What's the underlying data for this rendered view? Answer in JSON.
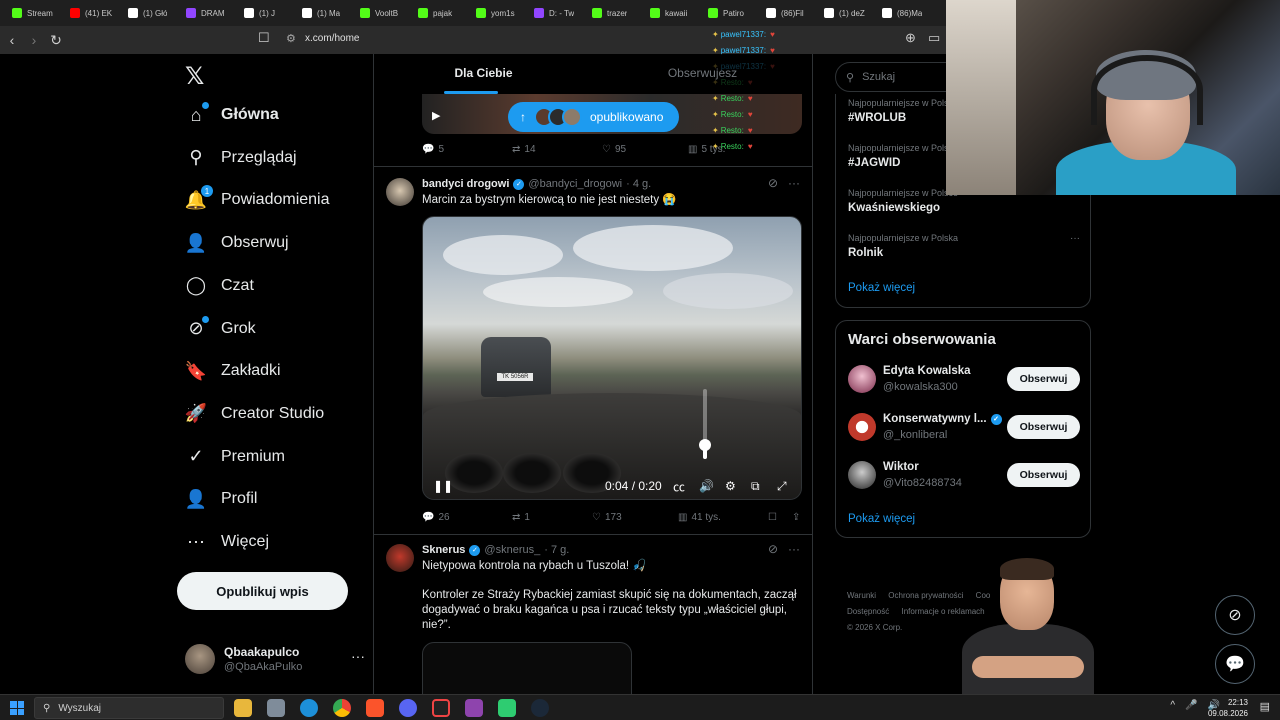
{
  "browser": {
    "tabs": [
      {
        "label": "Stream",
        "color": "#53fc18"
      },
      {
        "label": "(41) EK",
        "color": "#ff0000"
      },
      {
        "label": "(1) Głó",
        "color": "#ffffff"
      },
      {
        "label": "DRAM",
        "color": "#9146ff"
      },
      {
        "label": "(1) J",
        "color": "#ffffff"
      },
      {
        "label": "(1) Ma",
        "color": "#ffffff"
      },
      {
        "label": "VooltB",
        "color": "#53fc18"
      },
      {
        "label": "pajak",
        "color": "#53fc18"
      },
      {
        "label": "yom1s",
        "color": "#53fc18"
      },
      {
        "label": "D: - Tw",
        "color": "#9146ff"
      },
      {
        "label": "trazer",
        "color": "#53fc18"
      },
      {
        "label": "kawaii",
        "color": "#53fc18"
      },
      {
        "label": "Patiro",
        "color": "#53fc18"
      },
      {
        "label": "(86)Fil",
        "color": "#ffffff"
      },
      {
        "label": "(1) deZ",
        "color": "#ffffff"
      },
      {
        "label": "(86)Ma",
        "color": "#ffffff"
      }
    ],
    "url": "x.com/home"
  },
  "nav": {
    "items": [
      {
        "label": "Główna",
        "icon": "home-icon",
        "glyph": "⌂"
      },
      {
        "label": "Przeglądaj",
        "icon": "search-icon",
        "glyph": "⚲"
      },
      {
        "label": "Powiadomienia",
        "icon": "bell-icon",
        "glyph": "🔔",
        "badge": "1"
      },
      {
        "label": "Obserwuj",
        "icon": "person-add-icon",
        "glyph": "👤"
      },
      {
        "label": "Czat",
        "icon": "chat-icon",
        "glyph": "◯"
      },
      {
        "label": "Grok",
        "icon": "grok-icon",
        "glyph": "⊘"
      },
      {
        "label": "Zakładki",
        "icon": "bookmark-icon",
        "glyph": "🔖"
      },
      {
        "label": "Creator Studio",
        "icon": "rocket-icon",
        "glyph": "🚀"
      },
      {
        "label": "Premium",
        "icon": "verified-icon",
        "glyph": "✓"
      },
      {
        "label": "Profil",
        "icon": "profile-icon",
        "glyph": "👤"
      },
      {
        "label": "Więcej",
        "icon": "more-icon",
        "glyph": "⋯"
      }
    ],
    "post_button": "Opublikuj wpis",
    "user": {
      "name": "Qbaakapulco",
      "handle": "@QbaAkaPulko"
    }
  },
  "feed": {
    "tabs": [
      "Dla Ciebie",
      "Obserwujesz"
    ],
    "new_posts_pill": "opublikowano",
    "first_post_stats": {
      "replies": "5",
      "reposts": "14",
      "likes": "95",
      "views": "5 tys."
    },
    "tweets": [
      {
        "name": "bandyci drogowi",
        "handle": "@bandyci_drogowi",
        "time": "· 4 g.",
        "text": "Marcin za bystrym kierowcą to nie jest niestety 😭",
        "video": {
          "plate": "TK 5056R",
          "time": "0:04 / 0:20",
          "progress": 0.2,
          "volume": 0.25
        },
        "stats": {
          "replies": "26",
          "reposts": "1",
          "likes": "173",
          "views": "41 tys."
        }
      },
      {
        "name": "Sknerus",
        "handle": "@sknerus_",
        "time": "· 7 g.",
        "text": "Nietypowa kontrola na rybach u Tuszola! 🎣",
        "body": "Kontroler ze Straży Rybackiej zamiast skupić się na dokumentach, zaczął dogadywać o braku kagańca u psa i rzucać teksty typu „właściciel głupi, nie?”."
      }
    ]
  },
  "right": {
    "search_placeholder": "Szukaj",
    "trends": [
      {
        "category": "Najpopularniejsze w Polsce",
        "title": "#WROLUB"
      },
      {
        "category": "Najpopularniejsze w Polsce",
        "title": "#JAGWID"
      },
      {
        "category": "Najpopularniejsze w Polsce",
        "title": "Kwaśniewskiego"
      },
      {
        "category": "Najpopularniejsze w Polska",
        "title": "Rolnik"
      }
    ],
    "trends_more": "Pokaż więcej",
    "who_to_follow_title": "Warci obserwowania",
    "people": [
      {
        "name": "Edyta Kowalska",
        "handle": "@kowalska300",
        "verified": false,
        "follow": "Obserwuj"
      },
      {
        "name": "Konserwatywny l...",
        "handle": "@_konliberal",
        "verified": true,
        "follow": "Obserwuj"
      },
      {
        "name": "Wiktor",
        "handle": "@Vito82488734",
        "verified": false,
        "follow": "Obserwuj"
      }
    ],
    "people_more": "Pokaż więcej",
    "footer": [
      "Warunki",
      "Ochrona prywatności",
      "Coo",
      "Dostępność",
      "Informacje o reklamach",
      "© 2026 X Corp."
    ]
  },
  "chat": [
    {
      "user": "pawel71337:",
      "type": "user"
    },
    {
      "user": "pawel71337:",
      "type": "user"
    },
    {
      "user": "pawel71337:",
      "type": "user"
    },
    {
      "user": "Resto:",
      "type": "resto"
    },
    {
      "user": "Resto:",
      "type": "resto"
    },
    {
      "user": "Resto:",
      "type": "resto"
    },
    {
      "user": "Resto:",
      "type": "resto"
    },
    {
      "user": "Resto:",
      "type": "resto"
    }
  ],
  "taskbar": {
    "search": "Wyszukaj",
    "time": "22:13",
    "date": "09.08.2026"
  }
}
